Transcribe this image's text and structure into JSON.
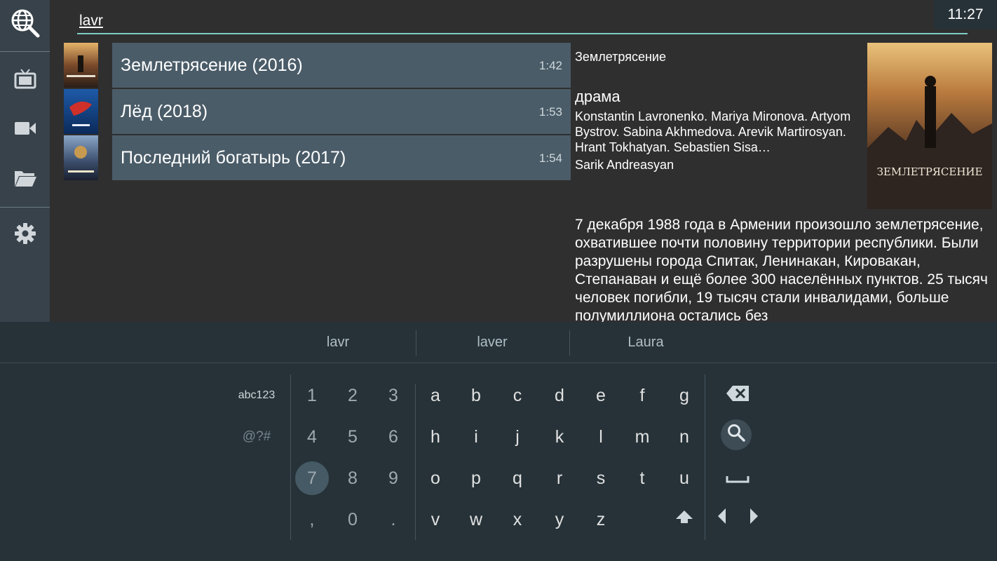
{
  "search": {
    "query": "lavr"
  },
  "clock": "11:27",
  "sidebar": {
    "items": [
      {
        "icon": "globe-search-icon"
      },
      {
        "icon": "tv-icon"
      },
      {
        "icon": "video-camera-icon"
      },
      {
        "icon": "folder-icon"
      },
      {
        "icon": "gear-icon"
      }
    ]
  },
  "results": [
    {
      "title": "Землетрясение (2016)",
      "time": "1:42"
    },
    {
      "title": "Лёд (2018)",
      "time": "1:53"
    },
    {
      "title": "Последний богатырь (2017)",
      "time": "1:54"
    }
  ],
  "details": {
    "title": "Землетрясение",
    "genre": "драма",
    "cast": "Konstantin Lavronenko. Mariya Mironova. Artyom Bystrov. Sabina Akhmedova. Arevik Martirosyan. Hrant Tokhatyan. Sebastien Sisa…",
    "director": "Sarik Andreasyan",
    "poster_text": "ЗЕМЛЕТРЯСЕНИЕ",
    "description": "7 декабря 1988 года в Армении произошло землетрясение, охватившее почти половину территории республики. Были разрушены города Спитак, Ленинакан, Кировакан, Степанаван и ещё более 300 населённых пунктов. 25 тысяч человек погибли, 19 тысяч стали инвалидами, больше полумиллиона остались без"
  },
  "keyboard": {
    "suggestions": [
      "lavr",
      "laver",
      "Laura"
    ],
    "modes": [
      "abc123",
      "@?#"
    ],
    "numpad": [
      [
        "1",
        "2",
        "3"
      ],
      [
        "4",
        "5",
        "6"
      ],
      [
        "7",
        "8",
        "9"
      ],
      [
        ",",
        "0",
        "."
      ]
    ],
    "letters": [
      [
        "a",
        "b",
        "c",
        "d",
        "e",
        "f",
        "g"
      ],
      [
        "h",
        "i",
        "j",
        "k",
        "l",
        "m",
        "n"
      ],
      [
        "o",
        "p",
        "q",
        "r",
        "s",
        "t",
        "u"
      ],
      [
        "v",
        "w",
        "x",
        "y",
        "z"
      ]
    ],
    "colors": {
      "accent": "#80cbc4",
      "focus": "#455a64"
    }
  }
}
